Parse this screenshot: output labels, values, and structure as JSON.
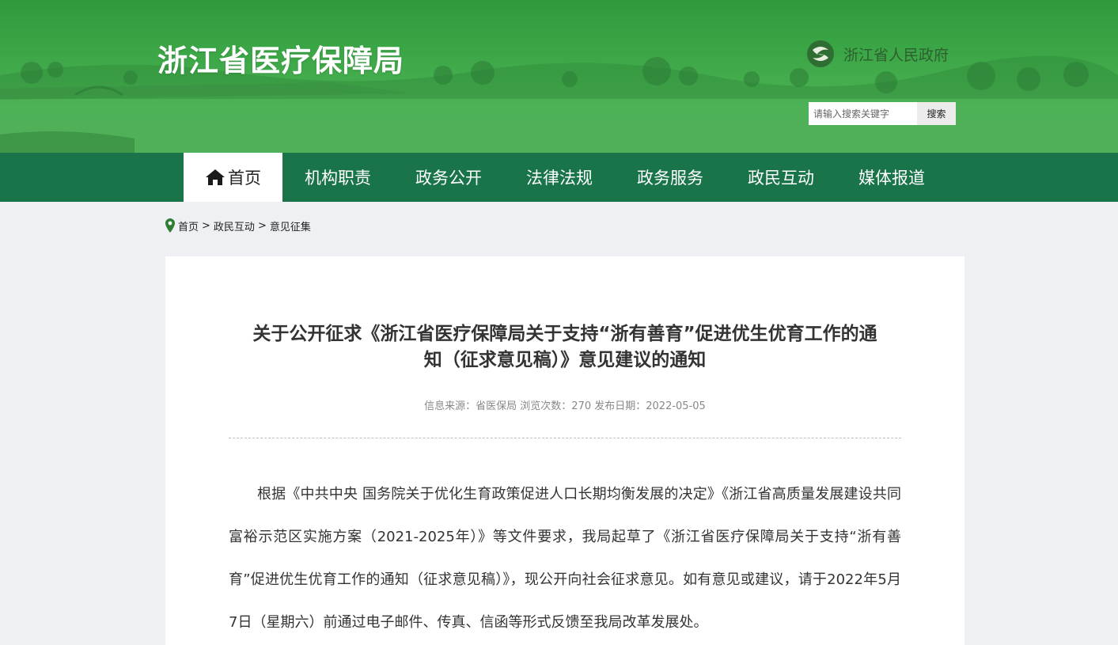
{
  "header": {
    "site_title": "浙江省医疗保障局",
    "gov_link_label": "浙江省人民政府",
    "search": {
      "placeholder": "请输入搜索关键字",
      "button_label": "搜索"
    }
  },
  "nav": {
    "items": [
      {
        "label": "首页",
        "active": true
      },
      {
        "label": "机构职责"
      },
      {
        "label": "政务公开"
      },
      {
        "label": "法律法规"
      },
      {
        "label": "政务服务"
      },
      {
        "label": "政民互动"
      },
      {
        "label": "媒体报道"
      }
    ]
  },
  "breadcrumb": {
    "items": [
      "首页",
      "政民互动",
      "意见征集"
    ],
    "separator": ">"
  },
  "article": {
    "title_line1": "关于公开征求《浙江省医疗保障局关于支持“浙有善育”促进优生优育工作的通",
    "title_line2": "知（征求意见稿）》意见建议的通知",
    "meta": "信息来源：省医保局 浏览次数：270 发布日期：2022-05-05",
    "body": "根据《中共中央 国务院关于优化生育政策促进人口长期均衡发展的决定》《浙江省高质量发展建设共同富裕示范区实施方案（2021-2025年）》等文件要求，我局起草了《浙江省医疗保障局关于支持“浙有善育”促进优生优育工作的通知（征求意见稿）》，现公开向社会征求意见。如有意见或建议，请于2022年5月7日（星期六）前通过电子邮件、传真、信函等形式反馈至我局改革发展处。"
  },
  "colors": {
    "nav_bg": "#19744a",
    "banner_green": "#3aa545",
    "page_bg": "#eef0f4"
  }
}
